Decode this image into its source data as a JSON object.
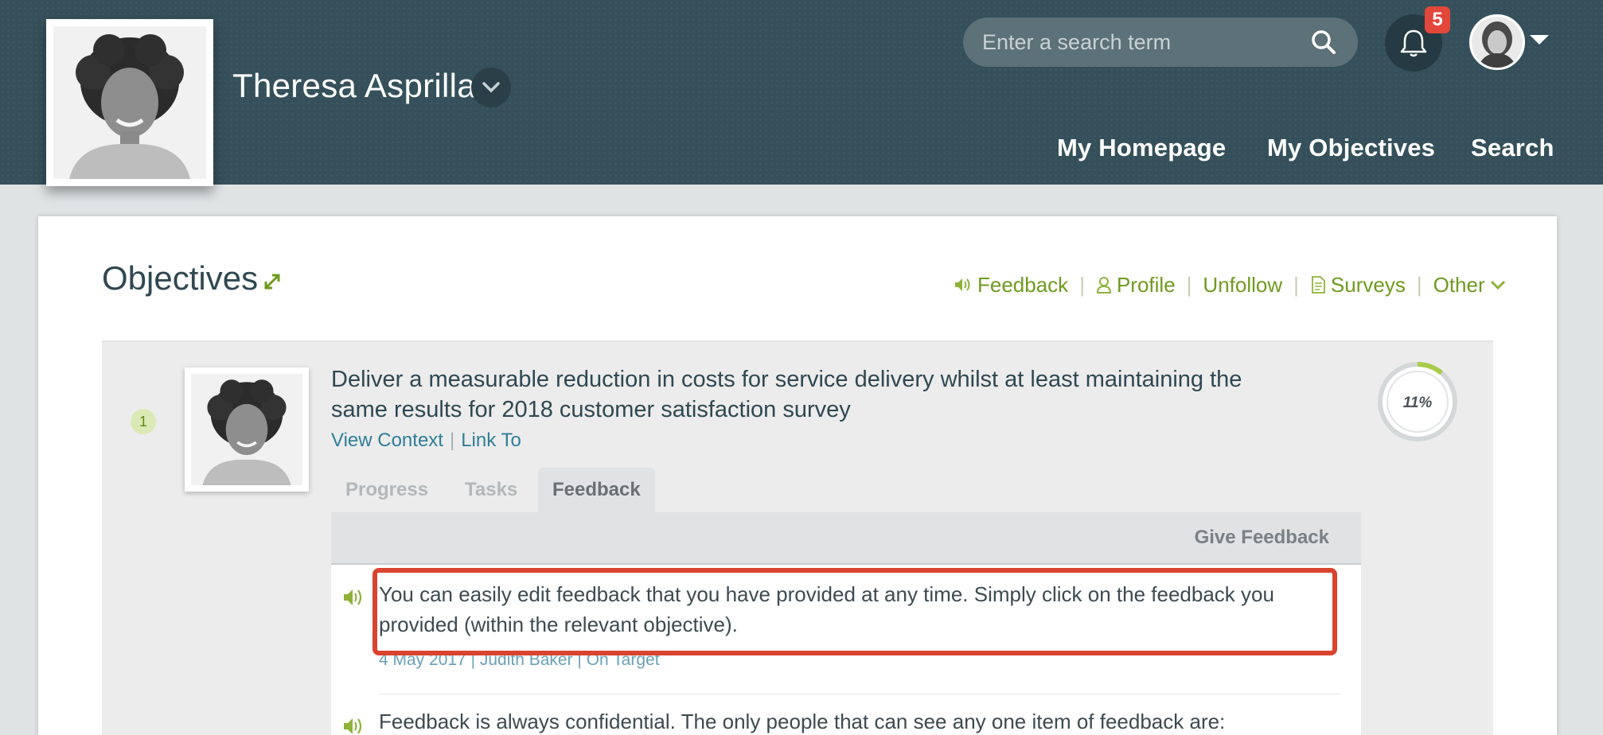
{
  "header": {
    "user_name": "Theresa Asprilla",
    "search_placeholder": "Enter a search term",
    "notification_count": "5",
    "nav": [
      "My Homepage",
      "My Objectives",
      "Search"
    ]
  },
  "page": {
    "title": "Objectives",
    "actions": [
      "Feedback",
      "Profile",
      "Unfollow",
      "Surveys",
      "Other"
    ]
  },
  "objective": {
    "number": "1",
    "text": "Deliver a measurable reduction in costs for service delivery whilst at least maintaining the same results for 2018 customer satisfaction survey",
    "links": [
      "View Context",
      "Link To"
    ],
    "progress_label": "11%",
    "progress_fraction": 0.11,
    "tabs": [
      "Progress",
      "Tasks",
      "Feedback"
    ],
    "active_tab": "Feedback",
    "give_feedback": "Give Feedback",
    "feedback": [
      {
        "text": "You can easily edit feedback that you have provided at any time. Simply click on the feedback you provided (within the relevant objective).",
        "meta": "4 May 2017 | Judith Baker | On Target"
      },
      {
        "text": "Feedback is always confidential. The only people that can see any one item of feedback are:"
      }
    ]
  },
  "colors": {
    "header_bg": "#35505a",
    "accent_green": "#6f9a1f",
    "link_blue": "#2f7d9a",
    "badge_red": "#e2473a",
    "highlight_red": "#d9432f"
  }
}
